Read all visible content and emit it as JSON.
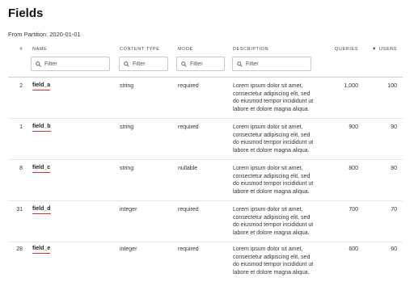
{
  "page": {
    "title": "Fields",
    "partition_label": "From Partition: 2020-01-01"
  },
  "columns": {
    "index": "#",
    "name": "NAME",
    "content_type": "CONTENT TYPE",
    "mode": "MODE",
    "description": "DESCRIPTION",
    "queries": "QUERIES",
    "users": "USERS",
    "users_sort_indicator": "▼"
  },
  "filters": {
    "name": {
      "placeholder": "Filter"
    },
    "content_type": {
      "placeholder": "Filter"
    },
    "mode": {
      "placeholder": "Filter"
    },
    "description": {
      "placeholder": "Filter"
    }
  },
  "rows": [
    {
      "index": "2",
      "name": "field_a",
      "content_type": "string",
      "mode": "required",
      "description": "Lorem ipsum dolor sit amet, consectetur adipiscing elit, sed do eiusmod tempor incididunt ut labore et dolore magna aliqua.",
      "queries": "1,000",
      "users": "100"
    },
    {
      "index": "1",
      "name": "field_b",
      "content_type": "string",
      "mode": "required",
      "description": "Lorem ipsum dolor sit amet, consectetur adipiscing elit, sed do eiusmod tempor incididunt ut labore et dolore magna aliqua.",
      "queries": "900",
      "users": "90"
    },
    {
      "index": "8",
      "name": "field_c",
      "content_type": "string",
      "mode": "nullable",
      "description": "Lorem ipsum dolor sit amet, consectetur adipiscing elit, sed do eiusmod tempor incididunt ut labore et dolore magna aliqua.",
      "queries": "800",
      "users": "80"
    },
    {
      "index": "31",
      "name": "field_d",
      "content_type": "integer",
      "mode": "required",
      "description": "Lorem ipsum dolor sit amet, consectetur adipiscing elit, sed do eiusmod tempor incididunt ut labore et dolore magna aliqua.",
      "queries": "700",
      "users": "70"
    },
    {
      "index": "28",
      "name": "field_e",
      "content_type": "integer",
      "mode": "required",
      "description": "Lorem ipsum dolor sit amet, consectetur adipiscing elit, sed do eiusmod tempor incididunt ut labore et dolore magna aliqua.",
      "queries": "600",
      "users": "60"
    }
  ],
  "icons": {
    "filter_search": "search-icon",
    "sort": "sort-desc-icon"
  },
  "colors": {
    "name_underline": "#e0302a"
  }
}
